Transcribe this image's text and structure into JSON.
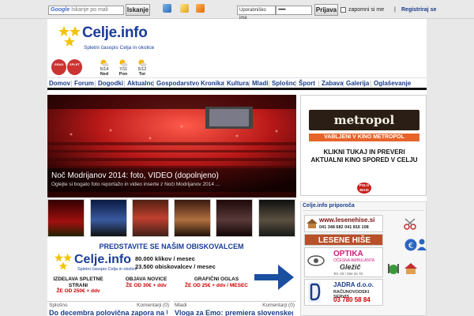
{
  "topbar": {
    "search_brand": "Google",
    "search_placeholder": "Iskanje po mali",
    "search_button": "Iskanje",
    "username_placeholder": "Uporabniško ime",
    "password_value": "••••••••",
    "login_button": "Prijava",
    "remember_label": "zapomni si me",
    "separator": "|",
    "register_link": "Registriraj se"
  },
  "header": {
    "title": "Celje.info",
    "subtitle": "Spletni časopis Celja in okolice",
    "weather_brand_a": "GRAD",
    "weather_brand_b": "SPLET",
    "weather": [
      {
        "temp": "5/14",
        "day": "Ned"
      },
      {
        "temp": "7/11",
        "day": "Pon"
      },
      {
        "temp": "5/12",
        "day": "Tor"
      }
    ]
  },
  "nav": {
    "items": [
      "Domov",
      "Forum",
      "Dogodki",
      "Aktualno",
      "Gospodarstvo",
      "Kronika",
      "Kultura",
      "Mladi",
      "Splošno",
      "Šport",
      "Zabava",
      "Galerija",
      "Oglaševanje"
    ]
  },
  "hero": {
    "title": "Noč Modrijanov 2014: foto, VIDEO (dopolnjeno)",
    "description": "Oglejte si bogato foto reportažo in video inserte z Noči Modrijanov 2014 ..."
  },
  "promo": {
    "headline": "PREDSTAVITE SE NAŠIM OBISKOVALCEM",
    "logo": "Celje.info",
    "logo_sub": "Spletni časopis Celja in okolice",
    "stat1": "80.000 klikov / mesec",
    "stat2": "23.500 obiskovalcev / mesec",
    "box1_a": "IZDELAVA SPLETNE STRANI",
    "box1_b": "ŽE OD 250€ + ddv",
    "box2_a": "OBJAVA NOVICE",
    "box2_b": "ŽE OD 30€ + ddv",
    "box3_a": "GRAFIČNI OGLAS",
    "box3_b": "ŽE OD 25€ + ddv / MESEC"
  },
  "articles": [
    {
      "category": "Splošno",
      "comments": "Komentarji (0)",
      "title": "Do decembra polovična zapora na U"
    },
    {
      "category": "Mladi",
      "comments": "Komentarji (0)",
      "title": "Vloga za Emo: premiera slovenskega"
    }
  ],
  "sidebar": {
    "metropol_logo": "metropol",
    "metropol_band": "VABLJENI V KINO METROPOL",
    "metropol_text": "KLIKNI TUKAJ IN PREVERI AKTUALNI KINO SPORED V CELJU",
    "polo_badge": "POLO MAXI",
    "recommends_title": "Celje.info priporoča",
    "ad1_url": "www.lesenehise.si",
    "ad1_phone": "041 348 682  041 816 108",
    "ad2": "LESENE HIŠE",
    "ad3_title": "OPTIKA",
    "ad3_sub": "OČESNA AMBULANTA",
    "ad3_brand": "Gležič",
    "ad3_note": "Tel. 03 / 492 34 70",
    "ad4_title": "JADRA d.o.o.",
    "ad4_sub": "RAČUNOVODSKI SERVIS",
    "ad4_phone": "03 780 58 84"
  },
  "colors": {
    "brand_blue": "#1a3d8a",
    "metropol_orange": "#e8632a",
    "ad_red": "#cc1e1e"
  }
}
